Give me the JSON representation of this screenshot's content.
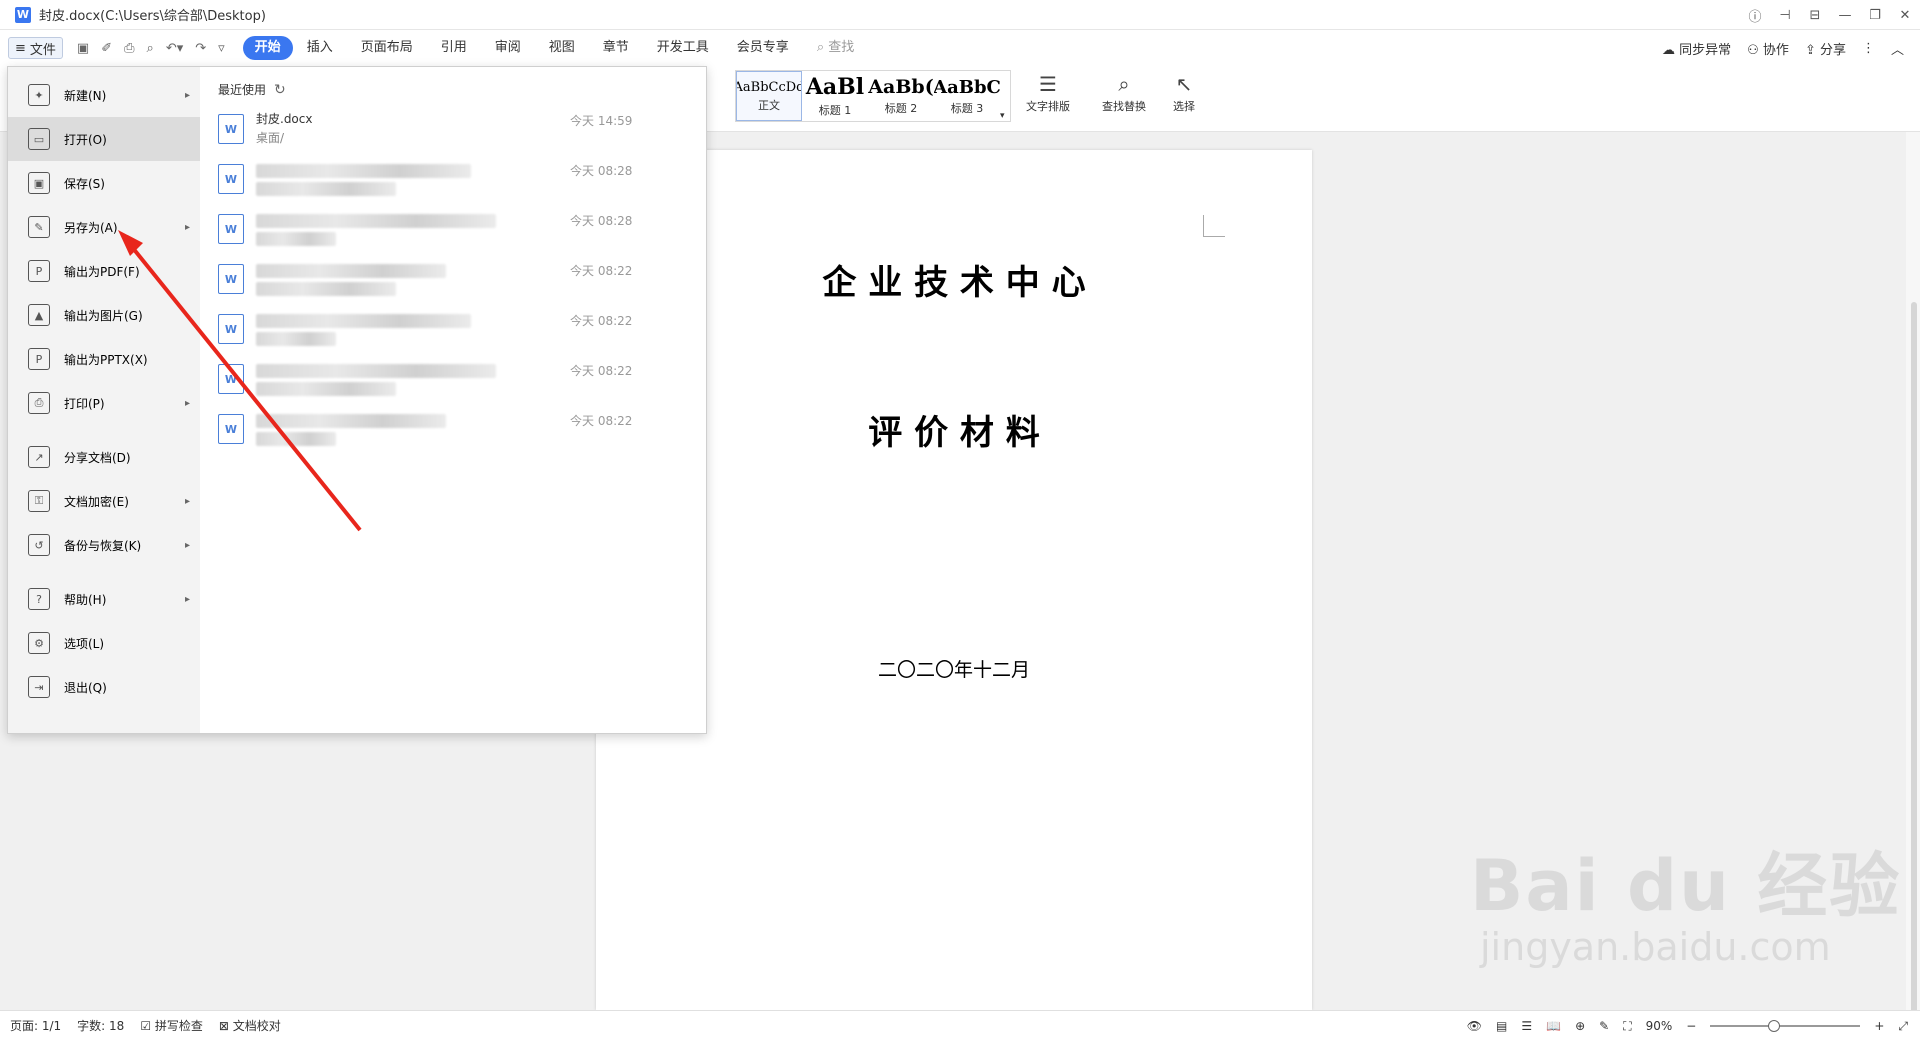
{
  "window": {
    "logo": "W",
    "title": "封皮.docx(C:\\Users\\综合部\\Desktop)",
    "controls": [
      "ⓘ",
      "⊣",
      "⊟",
      "—",
      "❐",
      "✕"
    ]
  },
  "toolbar": {
    "file_label": "文件",
    "tabs": [
      "开始",
      "插入",
      "页面布局",
      "引用",
      "审阅",
      "视图",
      "章节",
      "开发工具",
      "会员专享"
    ],
    "search_label": "查找",
    "sync_label": "同步异常",
    "collab_label": "协作",
    "share_label": "分享"
  },
  "ribbon": {
    "styles": [
      {
        "sample": "AaBbCcDd",
        "label": "正文"
      },
      {
        "sample": "AaBl",
        "label": "标题 1"
      },
      {
        "sample": "AaBb(",
        "label": "标题 2"
      },
      {
        "sample": "AaBbC",
        "label": "标题 3"
      }
    ],
    "text_layout": "文字排版",
    "find_replace": "查找替换",
    "select": "选择"
  },
  "file_menu": {
    "items": [
      {
        "label": "新建(N)",
        "icon": "new-doc-icon",
        "glyph": "✦",
        "submenu": true
      },
      {
        "label": "打开(O)",
        "icon": "open-folder-icon",
        "glyph": "▭",
        "submenu": false
      },
      {
        "label": "保存(S)",
        "icon": "save-icon",
        "glyph": "▣",
        "submenu": false
      },
      {
        "label": "另存为(A)",
        "icon": "save-as-icon",
        "glyph": "✎",
        "submenu": true
      },
      {
        "label": "输出为PDF(F)",
        "icon": "pdf-icon",
        "glyph": "P",
        "submenu": false
      },
      {
        "label": "输出为图片(G)",
        "icon": "image-icon",
        "glyph": "▲",
        "submenu": false
      },
      {
        "label": "输出为PPTX(X)",
        "icon": "pptx-icon",
        "glyph": "P",
        "submenu": false
      },
      {
        "label": "打印(P)",
        "icon": "print-icon",
        "glyph": "⎙",
        "submenu": true
      },
      {
        "label": "分享文档(D)",
        "icon": "share-icon",
        "glyph": "↗",
        "submenu": false
      },
      {
        "label": "文档加密(E)",
        "icon": "encrypt-icon",
        "glyph": "⚿",
        "submenu": true
      },
      {
        "label": "备份与恢复(K)",
        "icon": "backup-icon",
        "glyph": "↺",
        "submenu": true
      },
      {
        "label": "帮助(H)",
        "icon": "help-icon",
        "glyph": "?",
        "submenu": true
      },
      {
        "label": "选项(L)",
        "icon": "options-gear-icon",
        "glyph": "⚙",
        "submenu": false
      },
      {
        "label": "退出(Q)",
        "icon": "exit-icon",
        "glyph": "⇥",
        "submenu": false
      }
    ],
    "recent_title": "最近使用",
    "recent": [
      {
        "name": "封皮.docx",
        "path": "桌面/",
        "time": "今天 14:59"
      },
      {
        "name": "",
        "path": "",
        "time": "今天 08:28"
      },
      {
        "name": "",
        "path": "",
        "time": "今天 08:28"
      },
      {
        "name": "",
        "path": "",
        "time": "今天 08:22"
      },
      {
        "name": "",
        "path": "",
        "time": "今天 08:22"
      },
      {
        "name": "",
        "path": "",
        "time": "今天 08:22"
      },
      {
        "name": "",
        "path": "",
        "time": "今天 08:22"
      }
    ]
  },
  "document": {
    "title1": "企 业 技 术 中 心",
    "title2": "评  价  材  料",
    "date": "二〇二〇年十二月"
  },
  "watermark": {
    "main": "Bai du 经验",
    "sub": "jingyan.baidu.com"
  },
  "status": {
    "page": "页面: 1/1",
    "words": "字数: 18",
    "spell": "拼写检查",
    "proof": "文档校对",
    "zoom": "90%"
  },
  "colors": {
    "accent": "#3a77f0",
    "annotation": "#e8261c"
  }
}
